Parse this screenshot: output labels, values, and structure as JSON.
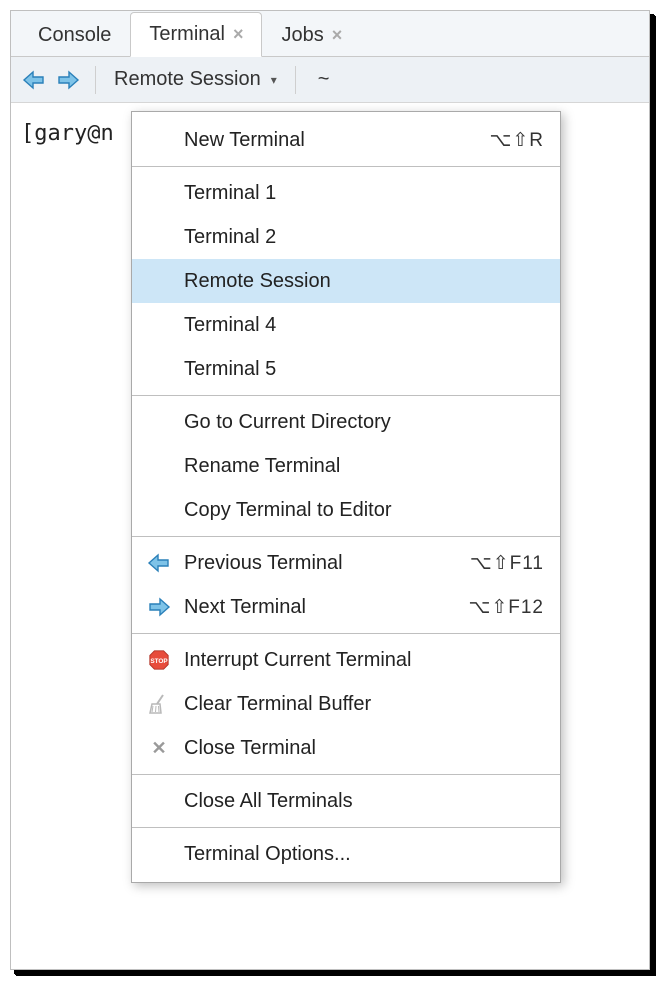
{
  "tabs": {
    "console": "Console",
    "terminal": "Terminal",
    "jobs": "Jobs"
  },
  "toolbar": {
    "dropdown_label": "Remote Session",
    "cwd": "~"
  },
  "terminal": {
    "prompt": "[gary@n"
  },
  "menu": {
    "new_terminal": "New Terminal",
    "new_terminal_shortcut": "⌥⇧R",
    "terminals": [
      "Terminal 1",
      "Terminal 2",
      "Remote Session",
      "Terminal 4",
      "Terminal 5"
    ],
    "go_to_current_dir": "Go to Current Directory",
    "rename_terminal": "Rename Terminal",
    "copy_to_editor": "Copy Terminal to Editor",
    "previous_terminal": "Previous Terminal",
    "previous_shortcut": "⌥⇧F11",
    "next_terminal": "Next Terminal",
    "next_shortcut": "⌥⇧F12",
    "interrupt": "Interrupt Current Terminal",
    "clear_buffer": "Clear Terminal Buffer",
    "close_terminal": "Close Terminal",
    "close_all": "Close All Terminals",
    "options": "Terminal Options..."
  }
}
